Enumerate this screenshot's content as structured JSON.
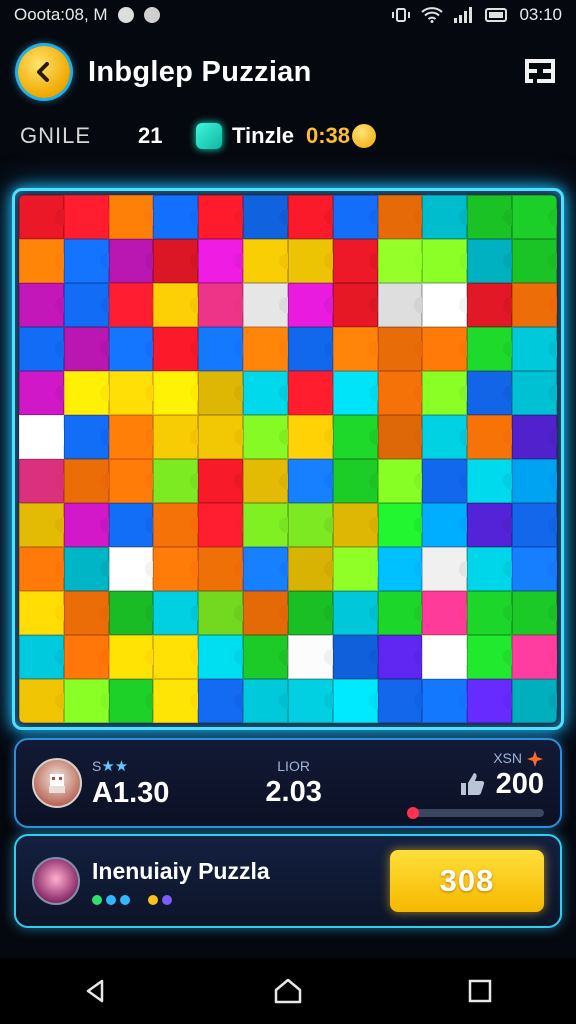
{
  "status_bar": {
    "left_text": "Ooota:08, M",
    "time": "03:10",
    "icons": [
      "circle-icon",
      "notification-icon",
      "vibrate-icon",
      "wifi-icon",
      "signal-icon",
      "battery-icon"
    ]
  },
  "header": {
    "title": "Inbglep Puzzian",
    "back_icon": "chevron-left-icon",
    "menu_icon": "menu-grid-icon"
  },
  "info": {
    "mode_label": "GNILE",
    "level": "21",
    "gem_icon": "gem-icon",
    "tinzle_label": "Tinzle",
    "timer": "0:38",
    "coin_icon": "coin-icon"
  },
  "board": {
    "rows": 12,
    "cols": 12,
    "palette": [
      "#e8212f",
      "#ff7a1a",
      "#ffd21f",
      "#2fd13a",
      "#15c8d8",
      "#1e6ff0",
      "#5a2ad8",
      "#c01fb8",
      "#ff3f8e",
      "#0fa8ff",
      "#ffffff",
      "#8cf03a"
    ]
  },
  "stats": {
    "stars": "★★",
    "stars_prefix": "S",
    "player_score": "A1.30",
    "mid_label": "LIOR",
    "mid_value": "2.03",
    "right_label": "XSN",
    "right_value": "200",
    "progress": 0.05,
    "avatar_icon": "avatar-icon",
    "thumb_icon": "thumbs-up-icon",
    "spark_icon": "spark-icon"
  },
  "card": {
    "title": "Inenuiaiy Puzzla",
    "play_value": "308",
    "dot_colors": [
      "#2fe06a",
      "#2fb8ff",
      "#2fb8ff",
      "#ffc21a",
      "#7a5cff"
    ]
  },
  "navbar": {
    "back_icon": "nav-back-icon",
    "home_icon": "nav-home-icon",
    "recents_icon": "nav-recents-icon"
  },
  "colors": {
    "accent_cyan": "#4fe0ff",
    "accent_yellow": "#ffd21f",
    "timer_color": "#ffbe2a"
  }
}
